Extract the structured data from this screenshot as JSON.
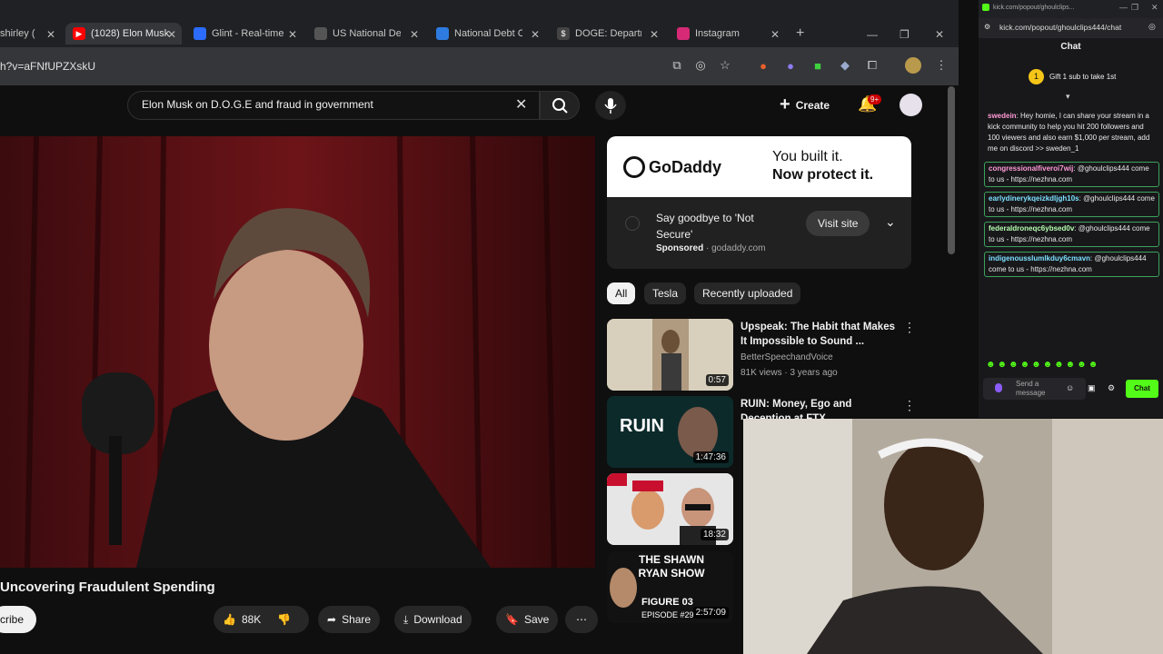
{
  "tabs": [
    {
      "label": "shirley (",
      "icon": "page-icon",
      "color": "#3c4043"
    },
    {
      "label": "(1028) Elon Musk",
      "icon": "youtube-icon",
      "color": "#ff0000"
    },
    {
      "label": "Glint - Real-time",
      "icon": "glint-icon",
      "color": "#2b6cff"
    },
    {
      "label": "US National Deb",
      "icon": "globe-icon",
      "color": "#555"
    },
    {
      "label": "National Debt C",
      "icon": "usdebt-icon",
      "color": "#2d7be0"
    },
    {
      "label": "DOGE: Departm",
      "icon": "doge-icon",
      "color": "#444"
    },
    {
      "label": "Instagram",
      "icon": "instagram-icon",
      "color": "#d62976"
    }
  ],
  "address": {
    "url": "h?v=aFNfUPZXskU"
  },
  "youtube": {
    "search_query": "Elon Musk on D.O.G.E and fraud in government",
    "create_label": "Create",
    "notif_badge": "9+",
    "video_title": "Uncovering Fraudulent Spending",
    "subscribe_label": "cribe",
    "like_count": "88K",
    "share_label": "Share",
    "download_label": "Download",
    "save_label": "Save"
  },
  "ad": {
    "brand": "GoDaddy",
    "headline_line1": "You built it.",
    "headline_line2": "Now protect it.",
    "text": "Say goodbye to 'Not Secure'",
    "sponsored": "Sponsored",
    "domain": "godaddy.com",
    "cta": "Visit site"
  },
  "chips": [
    "All",
    "Tesla",
    "Recently uploaded"
  ],
  "recs": [
    {
      "title": "Upspeak: The Habit that Makes It Impossible to Sound ...",
      "channel": "BetterSpeechandVoice",
      "meta": "81K views · 3 years ago",
      "duration": "0:57"
    },
    {
      "title": "RUIN: Money, Ego and Deception at FTX",
      "channel": "",
      "meta": "",
      "duration": "1:47:36",
      "thumb_text": "RUIN"
    },
    {
      "title": "",
      "channel": "",
      "meta": "",
      "duration": "18:32"
    },
    {
      "title": "",
      "channel": "",
      "meta": "",
      "duration": "2:57:09",
      "thumb_text": "THE SHAWN RYAN SHOW",
      "thumb_sub": "FIGURE 03",
      "thumb_ep": "EPISODE #29"
    }
  ],
  "chat": {
    "window_url": "kick.com/popout/ghoulclips...",
    "url": "kick.com/popout/ghoulclips444/chat",
    "title": "Chat",
    "gift_text": "Gift 1 sub to take 1st",
    "messages": [
      {
        "user": "swedein",
        "text": "Hey homie, I can share your stream in a kick community to help you hit 200 followers and 100 viewers and also earn $1,000 per stream, add me on discord >> sweden_1",
        "color": "#ff9ad5",
        "boxed": false
      },
      {
        "user": "congressionalfiveroi7wij",
        "text": "@ghoulclips444 come to us - https://nezhna.com",
        "color": "#ff9ad5",
        "boxed": true
      },
      {
        "user": "earlydinerykqeizkdljgh10s",
        "text": "@ghoulclips444 come to us - https://nezhna.com",
        "color": "#7ce0ff",
        "boxed": true
      },
      {
        "user": "federaldroneqc6ybsed0v",
        "text": "@ghoulclips444 come to us - https://nezhna.com",
        "color": "#b7ffb0",
        "boxed": true
      },
      {
        "user": "indigenousslumlkduy6cmavn",
        "text": "@ghoulclips444 come to us - https://nezhna.com",
        "color": "#7ce0ff",
        "boxed": true
      }
    ],
    "send_placeholder": "Send a message",
    "chat_button": "Chat"
  }
}
